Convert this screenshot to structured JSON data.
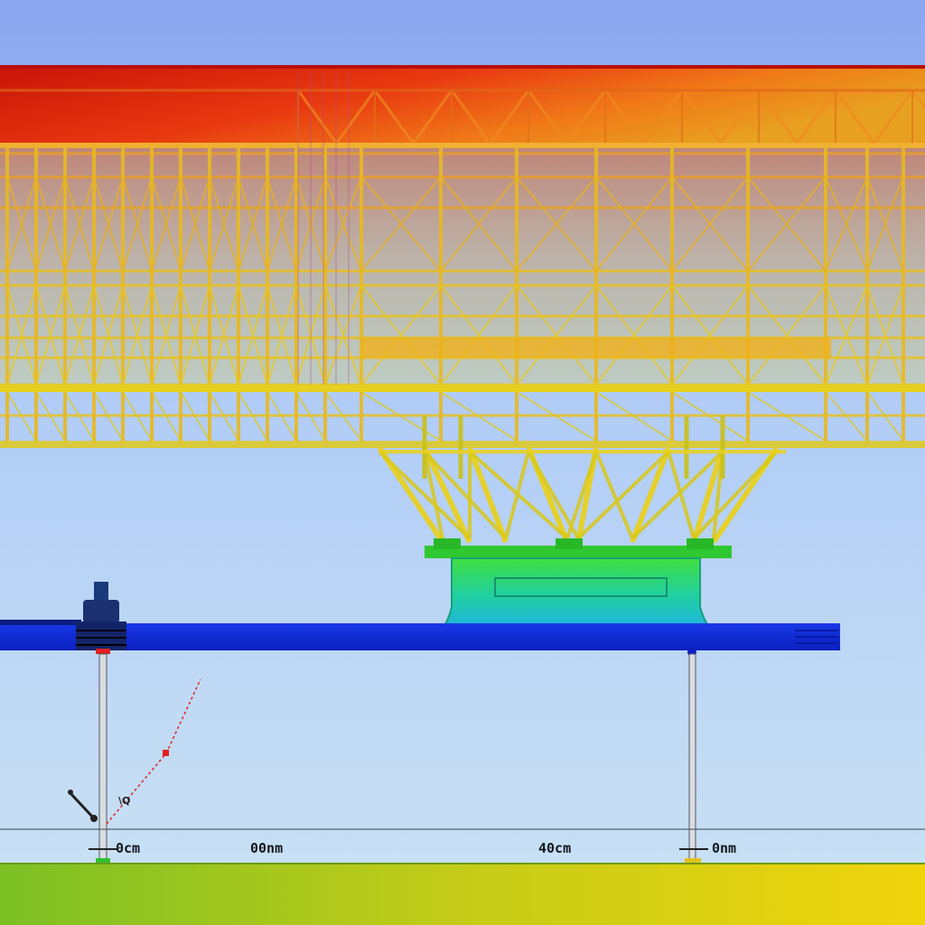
{
  "dimension_labels": {
    "left_support": "0cm",
    "span_a": "00nm",
    "span_b": "40cm",
    "right_support": "0nm"
  },
  "load_annotation": "\\Q",
  "colors": {
    "sky_top": "#8aa8f2",
    "sky_bottom": "#c4dcf6",
    "contour_hot": "#d81810",
    "contour_mid": "#f0c820",
    "contour_cool": "#30d040",
    "contour_cold": "#1030e0",
    "ground_left": "#80c020",
    "ground_right": "#f0d010",
    "dimension_marker": "#e02020"
  }
}
